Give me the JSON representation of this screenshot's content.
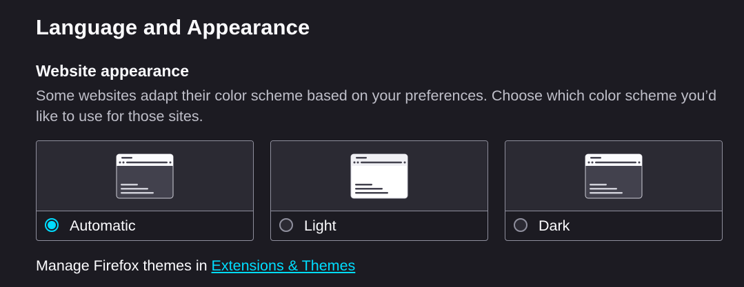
{
  "section": {
    "title": "Language and Appearance"
  },
  "website_appearance": {
    "heading": "Website appearance",
    "description": "Some websites adapt their color scheme based on your preferences. Choose which color scheme you’d like to use for those sites.",
    "options": [
      {
        "label": "Automatic",
        "selected": true
      },
      {
        "label": "Light",
        "selected": false
      },
      {
        "label": "Dark",
        "selected": false
      }
    ]
  },
  "themes": {
    "prefix": "Manage Firefox themes in ",
    "link_label": "Extensions & Themes"
  },
  "colors": {
    "background": "#1c1b22",
    "card_preview": "#2b2a33",
    "accent": "#00ddff",
    "border": "#8f8f9d"
  }
}
